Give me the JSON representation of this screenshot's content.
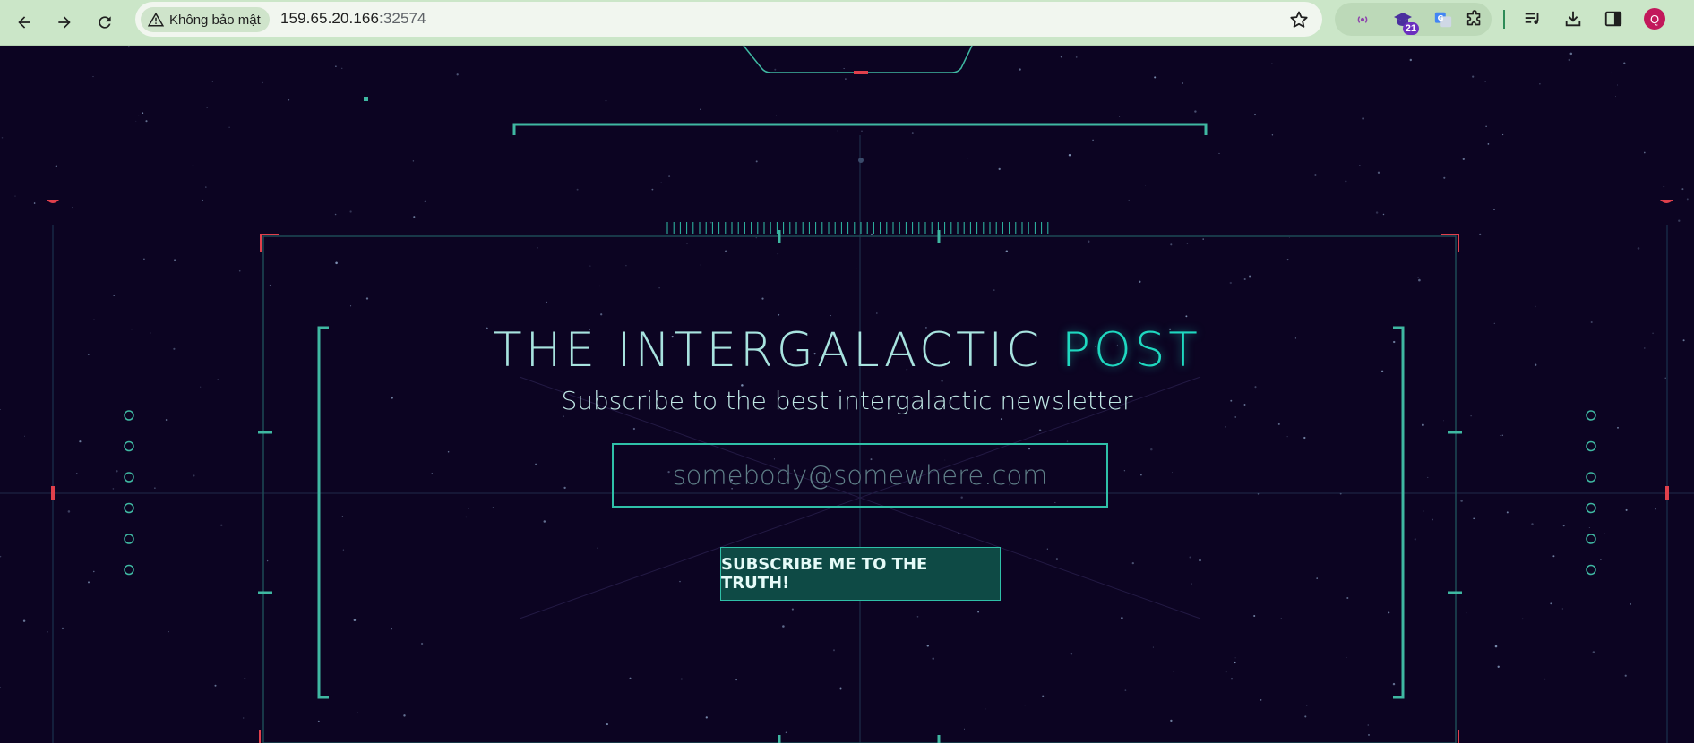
{
  "browser": {
    "security_label": "Không bảo mật",
    "url_host": "159.65.20.166",
    "url_port": ":32574",
    "extension_badge": "21",
    "profile_initial": "Q",
    "icons": [
      "back-icon",
      "forward-icon",
      "reload-icon",
      "warning-icon",
      "star-icon",
      "broadcast-icon",
      "extension-cap-icon",
      "translate-icon",
      "puzzle-icon",
      "media-queue-icon",
      "download-icon",
      "side-panel-icon"
    ]
  },
  "page": {
    "title_main": "THE INTERGALACTIC ",
    "title_accent": "POST",
    "subtitle": "Subscribe to the best intergalactic newsletter",
    "email_placeholder": "somebody@somewhere.com",
    "subscribe_label": "SUBSCRIBE ME TO THE TRUTH!"
  },
  "colors": {
    "background": "#0c0422",
    "accent": "#1fd8c0",
    "hud_line": "#3fb8a2",
    "hud_red": "#e0404c",
    "button_bg": "#0e4a45"
  }
}
